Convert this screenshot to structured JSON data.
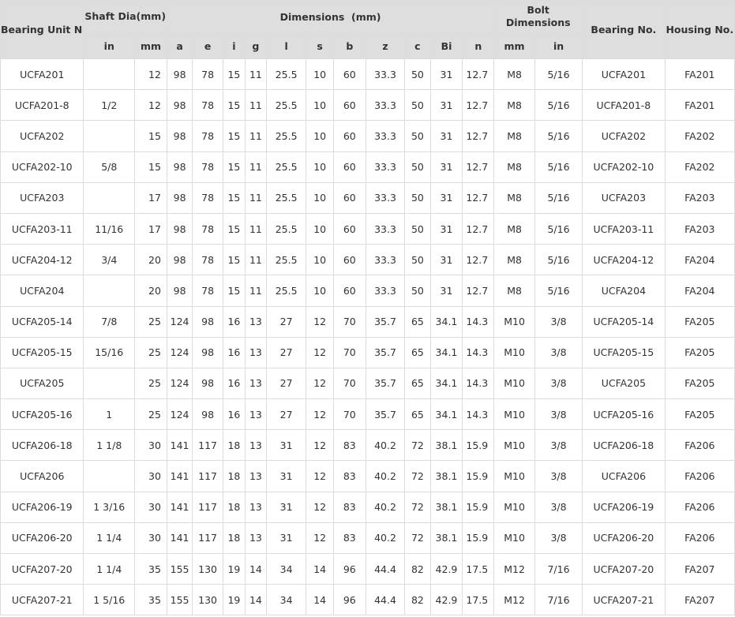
{
  "headers": {
    "bearing_unit": "Bearing Unit No.",
    "shaft": "Shaft Dia(mm)",
    "dimensions": "Dimensions  (mm)",
    "bolt": "Bolt Dimensions",
    "bearing_no": "Bearing No.",
    "housing": "Housing No.",
    "sub": [
      "in",
      "mm",
      "a",
      "e",
      "i",
      "g",
      "l",
      "s",
      "b",
      "z",
      "c",
      "Bi",
      "n",
      "mm",
      "in"
    ]
  },
  "rows": [
    [
      "UCFA201",
      "",
      "12",
      "98",
      "78",
      "15",
      "11",
      "25.5",
      "10",
      "60",
      "33.3",
      "50",
      "31",
      "12.7",
      "M8",
      "5/16",
      "UCFA201",
      "FA201"
    ],
    [
      "UCFA201-8",
      "1/2",
      "12",
      "98",
      "78",
      "15",
      "11",
      "25.5",
      "10",
      "60",
      "33.3",
      "50",
      "31",
      "12.7",
      "M8",
      "5/16",
      "UCFA201-8",
      "FA201"
    ],
    [
      "UCFA202",
      "",
      "15",
      "98",
      "78",
      "15",
      "11",
      "25.5",
      "10",
      "60",
      "33.3",
      "50",
      "31",
      "12.7",
      "M8",
      "5/16",
      "UCFA202",
      "FA202"
    ],
    [
      "UCFA202-10",
      "5/8",
      "15",
      "98",
      "78",
      "15",
      "11",
      "25.5",
      "10",
      "60",
      "33.3",
      "50",
      "31",
      "12.7",
      "M8",
      "5/16",
      "UCFA202-10",
      "FA202"
    ],
    [
      "UCFA203",
      "",
      "17",
      "98",
      "78",
      "15",
      "11",
      "25.5",
      "10",
      "60",
      "33.3",
      "50",
      "31",
      "12.7",
      "M8",
      "5/16",
      "UCFA203",
      "FA203"
    ],
    [
      "UCFA203-11",
      "11/16",
      "17",
      "98",
      "78",
      "15",
      "11",
      "25.5",
      "10",
      "60",
      "33.3",
      "50",
      "31",
      "12.7",
      "M8",
      "5/16",
      "UCFA203-11",
      "FA203"
    ],
    [
      "UCFA204-12",
      "3/4",
      "20",
      "98",
      "78",
      "15",
      "11",
      "25.5",
      "10",
      "60",
      "33.3",
      "50",
      "31",
      "12.7",
      "M8",
      "5/16",
      "UCFA204-12",
      "FA204"
    ],
    [
      "UCFA204",
      "",
      "20",
      "98",
      "78",
      "15",
      "11",
      "25.5",
      "10",
      "60",
      "33.3",
      "50",
      "31",
      "12.7",
      "M8",
      "5/16",
      "UCFA204",
      "FA204"
    ],
    [
      "UCFA205-14",
      "7/8",
      "25",
      "124",
      "98",
      "16",
      "13",
      "27",
      "12",
      "70",
      "35.7",
      "65",
      "34.1",
      "14.3",
      "M10",
      "3/8",
      "UCFA205-14",
      "FA205"
    ],
    [
      "UCFA205-15",
      "15/16",
      "25",
      "124",
      "98",
      "16",
      "13",
      "27",
      "12",
      "70",
      "35.7",
      "65",
      "34.1",
      "14.3",
      "M10",
      "3/8",
      "UCFA205-15",
      "FA205"
    ],
    [
      "UCFA205",
      "",
      "25",
      "124",
      "98",
      "16",
      "13",
      "27",
      "12",
      "70",
      "35.7",
      "65",
      "34.1",
      "14.3",
      "M10",
      "3/8",
      "UCFA205",
      "FA205"
    ],
    [
      "UCFA205-16",
      "1",
      "25",
      "124",
      "98",
      "16",
      "13",
      "27",
      "12",
      "70",
      "35.7",
      "65",
      "34.1",
      "14.3",
      "M10",
      "3/8",
      "UCFA205-16",
      "FA205"
    ],
    [
      "UCFA206-18",
      "1 1/8",
      "30",
      "141",
      "117",
      "18",
      "13",
      "31",
      "12",
      "83",
      "40.2",
      "72",
      "38.1",
      "15.9",
      "M10",
      "3/8",
      "UCFA206-18",
      "FA206"
    ],
    [
      "UCFA206",
      "",
      "30",
      "141",
      "117",
      "18",
      "13",
      "31",
      "12",
      "83",
      "40.2",
      "72",
      "38.1",
      "15.9",
      "M10",
      "3/8",
      "UCFA206",
      "FA206"
    ],
    [
      "UCFA206-19",
      "1 3/16",
      "30",
      "141",
      "117",
      "18",
      "13",
      "31",
      "12",
      "83",
      "40.2",
      "72",
      "38.1",
      "15.9",
      "M10",
      "3/8",
      "UCFA206-19",
      "FA206"
    ],
    [
      "UCFA206-20",
      "1 1/4",
      "30",
      "141",
      "117",
      "18",
      "13",
      "31",
      "12",
      "83",
      "40.2",
      "72",
      "38.1",
      "15.9",
      "M10",
      "3/8",
      "UCFA206-20",
      "FA206"
    ],
    [
      "UCFA207-20",
      "1 1/4",
      "35",
      "155",
      "130",
      "19",
      "14",
      "34",
      "14",
      "96",
      "44.4",
      "82",
      "42.9",
      "17.5",
      "M12",
      "7/16",
      "UCFA207-20",
      "FA207"
    ],
    [
      "UCFA207-21",
      "1 5/16",
      "35",
      "155",
      "130",
      "19",
      "14",
      "34",
      "14",
      "96",
      "44.4",
      "82",
      "42.9",
      "17.5",
      "M12",
      "7/16",
      "UCFA207-21",
      "FA207"
    ]
  ]
}
